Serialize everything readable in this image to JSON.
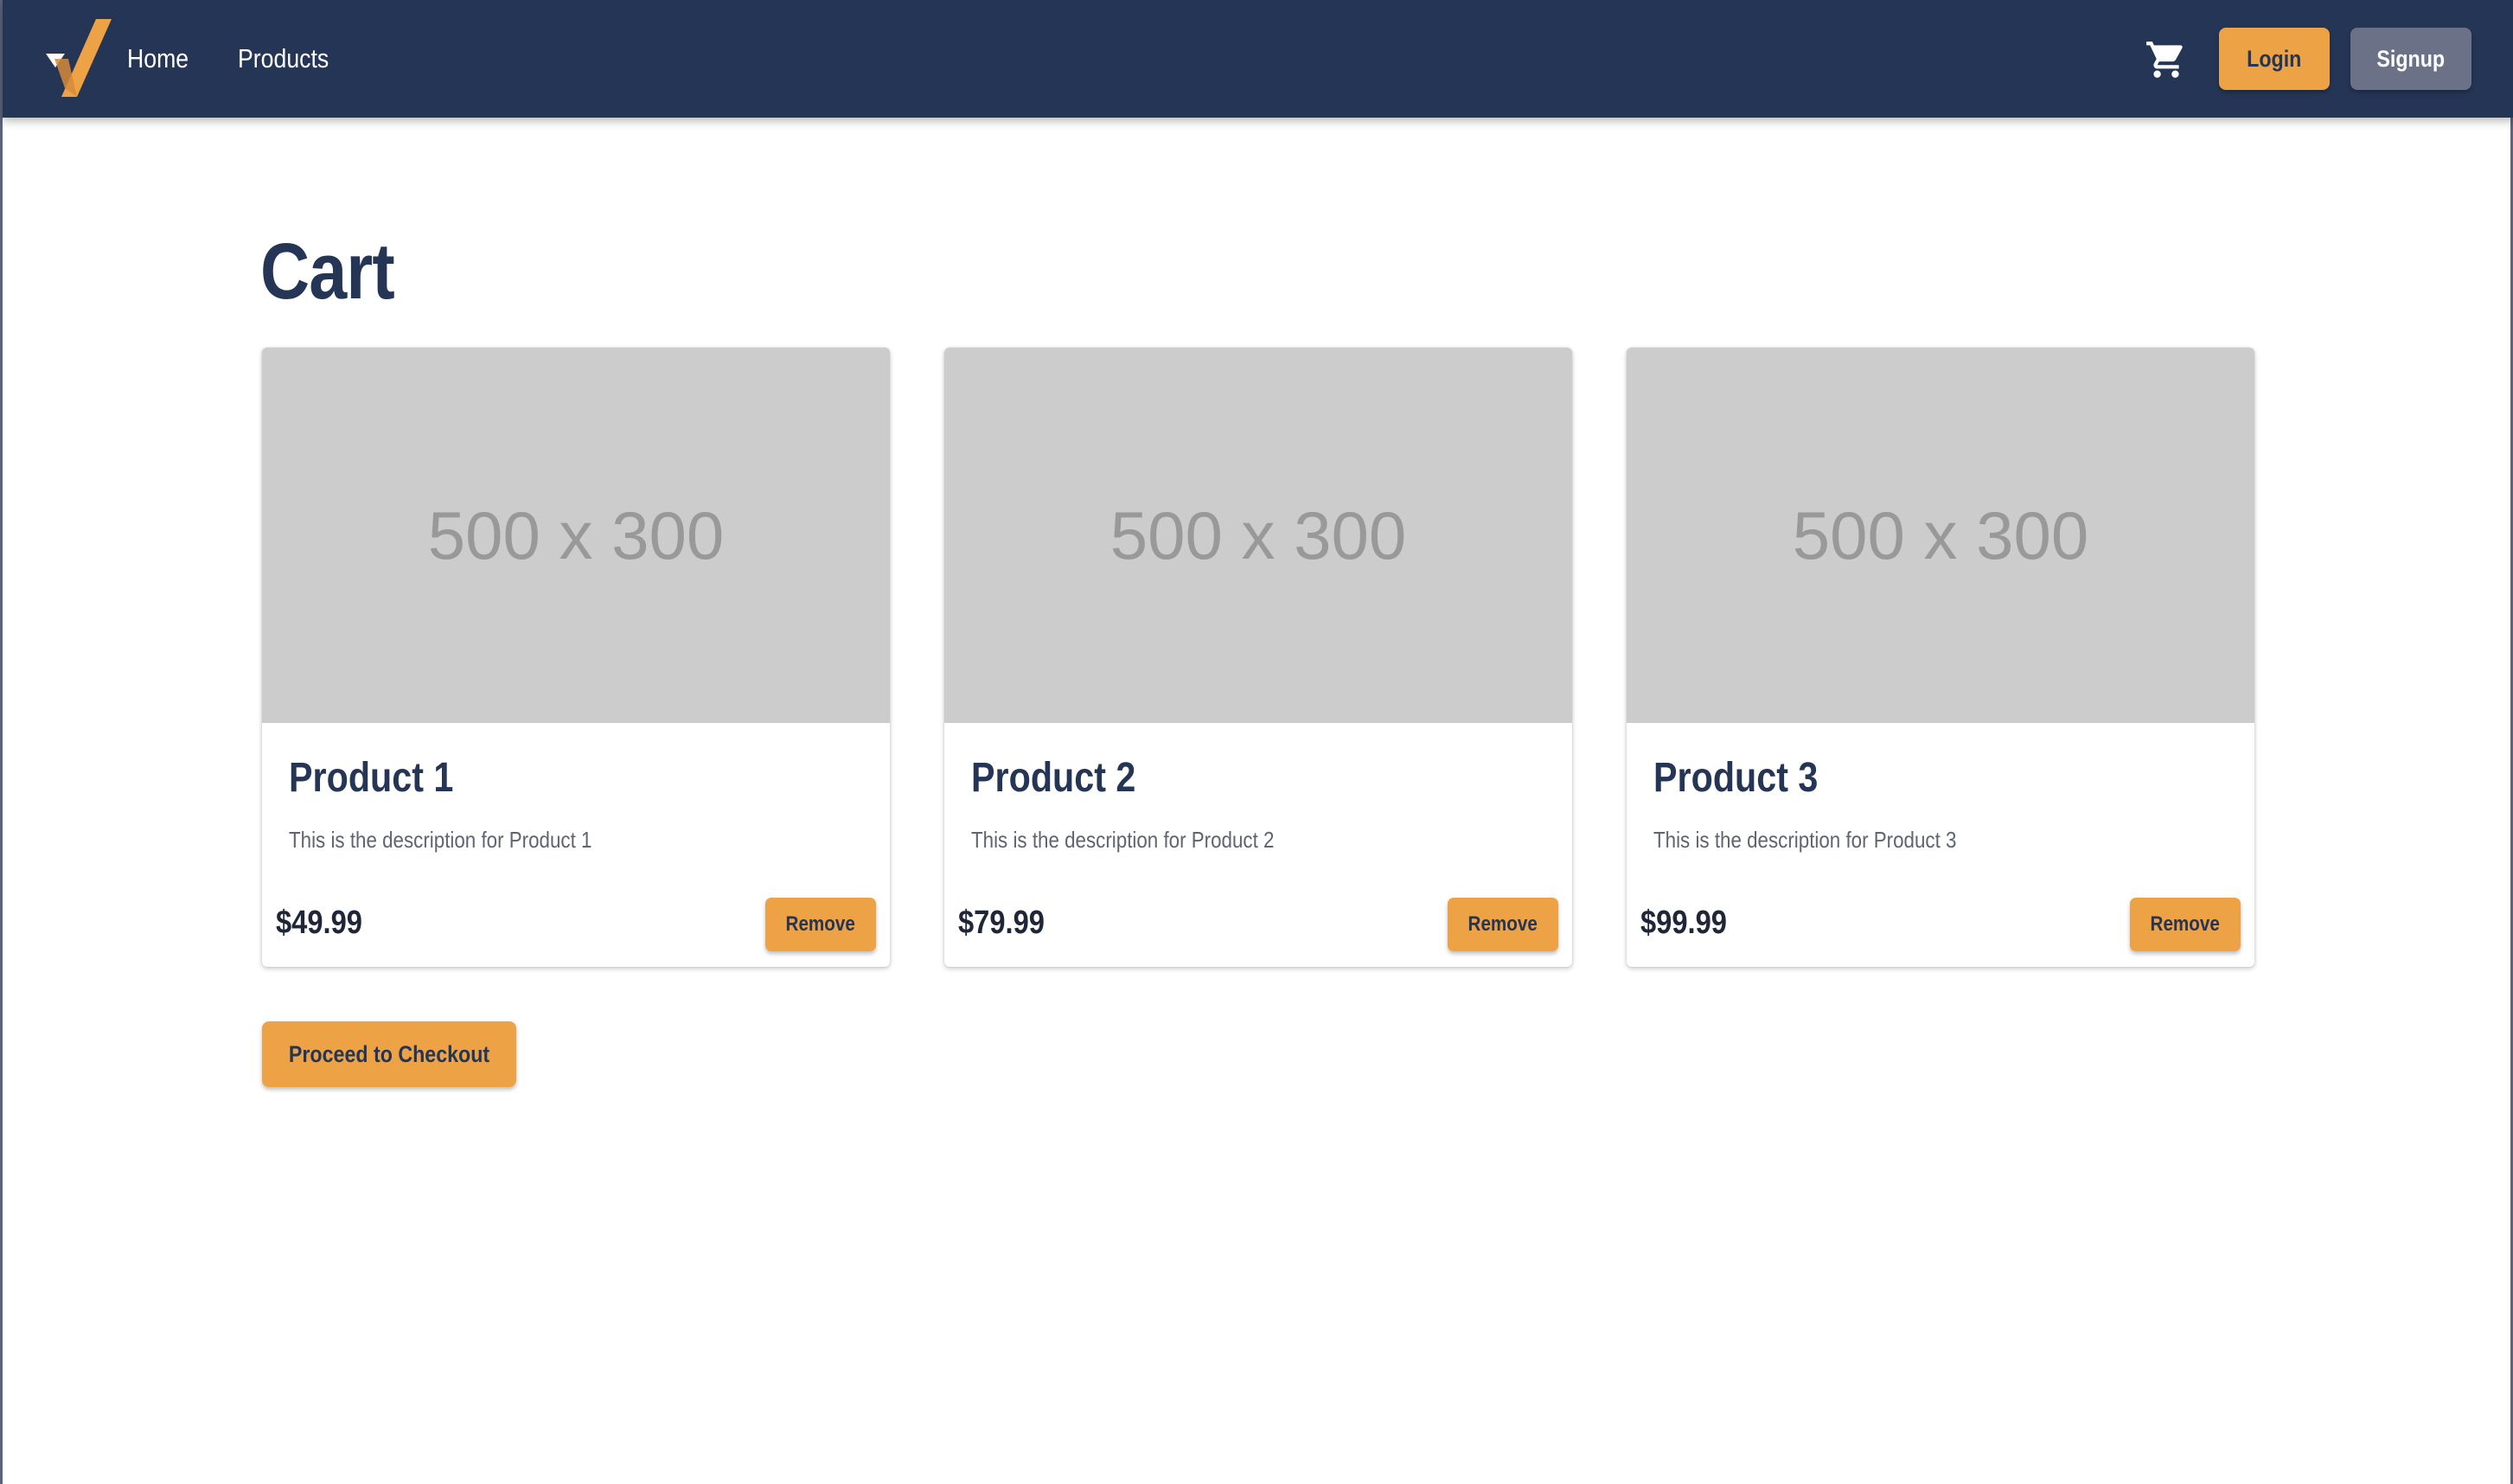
{
  "navbar": {
    "logo_icon": "checkmark-logo-icon",
    "links": [
      {
        "label": "Home"
      },
      {
        "label": "Products"
      }
    ],
    "cart_icon": "shopping-cart-icon",
    "login_label": "Login",
    "signup_label": "Signup"
  },
  "main": {
    "title": "Cart",
    "items": [
      {
        "image_text": "500 x 300",
        "name": "Product 1",
        "description": "This is the description for Product 1",
        "price": "$49.99",
        "remove_label": "Remove"
      },
      {
        "image_text": "500 x 300",
        "name": "Product 2",
        "description": "This is the description for Product 2",
        "price": "$79.99",
        "remove_label": "Remove"
      },
      {
        "image_text": "500 x 300",
        "name": "Product 3",
        "description": "This is the description for Product 3",
        "price": "$99.99",
        "remove_label": "Remove"
      }
    ],
    "checkout_label": "Proceed to Checkout"
  },
  "colors": {
    "navbar_bg": "#253556",
    "accent": "#eda345",
    "secondary_button": "#6b7288",
    "placeholder_bg": "#cccccc"
  }
}
